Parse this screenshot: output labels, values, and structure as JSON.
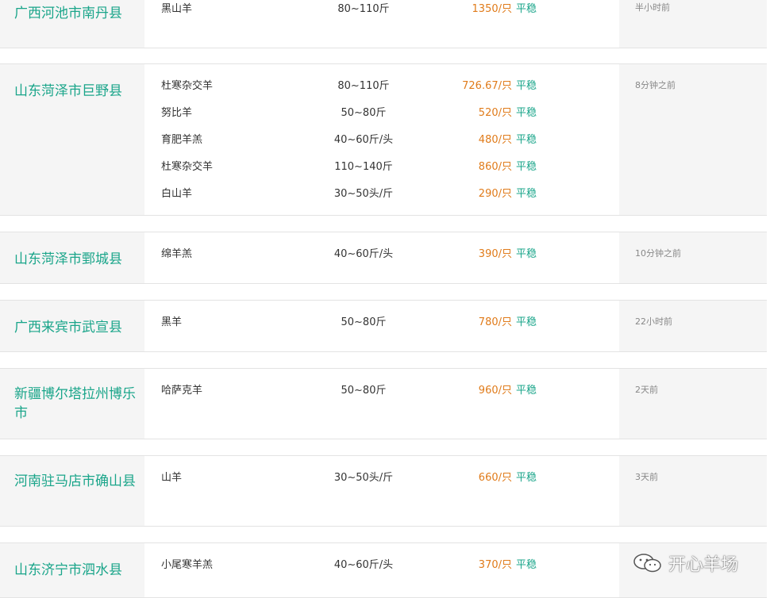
{
  "cards": [
    {
      "region": "广西河池市南丹县",
      "time": "半小时前",
      "rows": [
        {
          "breed": "黑山羊",
          "weight": "80~110斤",
          "price": "1350/只",
          "trend": "平稳"
        }
      ]
    },
    {
      "region": "山东菏泽市巨野县",
      "time": "8分钟之前",
      "rows": [
        {
          "breed": "杜寒杂交羊",
          "weight": "80~110斤",
          "price": "726.67/只",
          "trend": "平稳"
        },
        {
          "breed": "努比羊",
          "weight": "50~80斤",
          "price": "520/只",
          "trend": "平稳"
        },
        {
          "breed": "育肥羊羔",
          "weight": "40~60斤/头",
          "price": "480/只",
          "trend": "平稳"
        },
        {
          "breed": "杜寒杂交羊",
          "weight": "110~140斤",
          "price": "860/只",
          "trend": "平稳"
        },
        {
          "breed": "白山羊",
          "weight": "30~50头/斤",
          "price": "290/只",
          "trend": "平稳"
        }
      ]
    },
    {
      "region": "山东菏泽市鄄城县",
      "time": "10分钟之前",
      "rows": [
        {
          "breed": "绵羊羔",
          "weight": "40~60斤/头",
          "price": "390/只",
          "trend": "平稳"
        }
      ]
    },
    {
      "region": "广西来宾市武宣县",
      "time": "22小时前",
      "rows": [
        {
          "breed": "黑羊",
          "weight": "50~80斤",
          "price": "780/只",
          "trend": "平稳"
        }
      ]
    },
    {
      "region": "新疆博尔塔拉州博乐市",
      "time": "2天前",
      "rows": [
        {
          "breed": "哈萨克羊",
          "weight": "50~80斤",
          "price": "960/只",
          "trend": "平稳"
        }
      ]
    },
    {
      "region": "河南驻马店市确山县",
      "time": "3天前",
      "rows": [
        {
          "breed": "山羊",
          "weight": "30~50头/斤",
          "price": "660/只",
          "trend": "平稳"
        }
      ]
    },
    {
      "region": "山东济宁市泗水县",
      "time": "",
      "rows": [
        {
          "breed": "小尾寒羊羔",
          "weight": "40~60斤/头",
          "price": "370/只",
          "trend": "平稳"
        }
      ]
    }
  ],
  "watermark": {
    "icon": "wechat-icon",
    "text": "开心羊场"
  }
}
